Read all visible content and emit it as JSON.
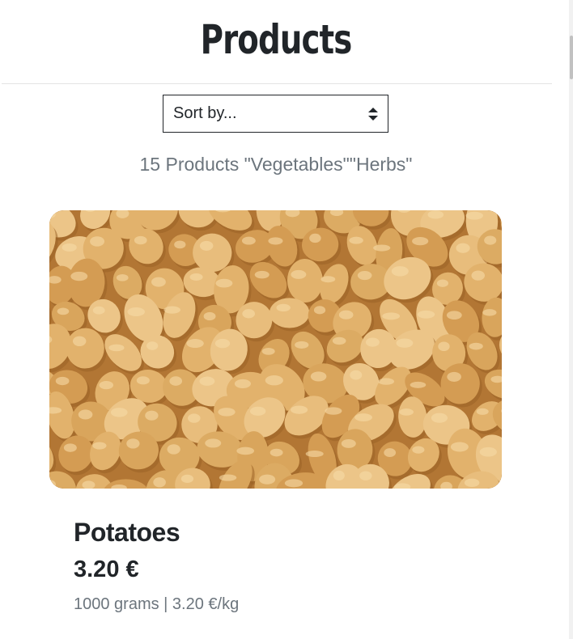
{
  "header": {
    "title": "Products"
  },
  "sort": {
    "label": "Sort by...",
    "icon": "sort-arrows-icon"
  },
  "results": {
    "count_text": "15 Products \"Vegetables\"\"Herbs\""
  },
  "products": [
    {
      "name": "Potatoes",
      "price": "3.20 €",
      "unit_info": "1000 grams | 3.20 €/kg",
      "image": "potatoes-photo"
    }
  ],
  "colors": {
    "text": "#212529",
    "muted": "#6c757d",
    "potato_base": "#c98d40",
    "potato_light": "#e3b46e"
  }
}
